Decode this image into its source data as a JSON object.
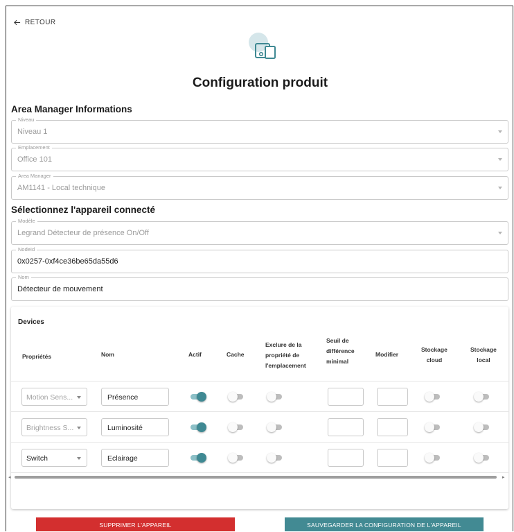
{
  "back_label": "RETOUR",
  "page_title": "Configuration produit",
  "area_section": {
    "title": "Area Manager Informations",
    "fields": [
      {
        "legend": "Niveau",
        "value": "Niveau 1"
      },
      {
        "legend": "Emplacement",
        "value": "Office 101"
      },
      {
        "legend": "Area Manager",
        "value": "AM1141 - Local technique"
      }
    ]
  },
  "device_section": {
    "title": "Sélectionnez l'appareil connecté",
    "model": {
      "legend": "Modèle",
      "value": "Legrand  Détecteur de présence  On/Off"
    },
    "nodeid": {
      "legend": "NodeId",
      "value": "0x0257-0xf4ce36be65da55d6"
    },
    "name": {
      "legend": "Nom",
      "value": "Détecteur de mouvement"
    }
  },
  "devices": {
    "title": "Devices",
    "headers": {
      "proprietes": "Propriétés",
      "nom": "Nom",
      "actif": "Actif",
      "cache": "Cache",
      "exclure": [
        "Exclure de la",
        "propriété de",
        "l'emplacement"
      ],
      "seuil": [
        "Seuil de",
        "différence",
        "minimal"
      ],
      "modifier": "Modifier",
      "stockage_cloud": [
        "Stockage",
        "cloud"
      ],
      "stockage_local": [
        "Stockage",
        "local"
      ]
    },
    "rows": [
      {
        "propriete": "Motion Sens...",
        "nom": "Présence",
        "actif": true,
        "cache": false,
        "exclure": false,
        "stockage_cloud": false,
        "stockage_local": false
      },
      {
        "propriete": "Brightness S...",
        "nom": "Luminosité",
        "actif": true,
        "cache": false,
        "exclure": false,
        "stockage_cloud": false,
        "stockage_local": false
      },
      {
        "propriete": "Switch",
        "nom": "Eclairage",
        "actif": true,
        "cache": false,
        "exclure": false,
        "stockage_cloud": false,
        "stockage_local": false
      }
    ]
  },
  "buttons": {
    "delete": "SUPPRIMER L'APPAREIL",
    "save": "SAUVEGARDER LA CONFIGURATION DE L'APPAREIL"
  },
  "colors": {
    "accent": "#428a93",
    "danger": "#d32f2f"
  }
}
